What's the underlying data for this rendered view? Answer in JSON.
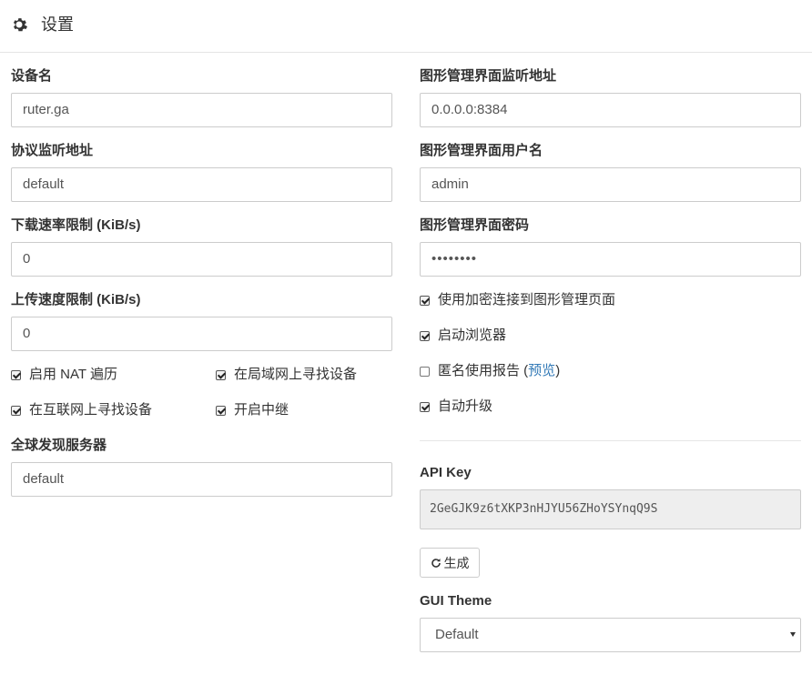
{
  "header": {
    "title": "设置",
    "icon": "gear-icon"
  },
  "left": {
    "device_name": {
      "label": "设备名",
      "value": "ruter.ga"
    },
    "protocol_listen": {
      "label": "协议监听地址",
      "value": "default"
    },
    "download_limit": {
      "label": "下载速率限制 (KiB/s)",
      "value": "0"
    },
    "upload_limit": {
      "label": "上传速度限制 (KiB/s)",
      "value": "0"
    },
    "checkboxes": {
      "nat": {
        "label": "启用 NAT 遍历",
        "checked": true
      },
      "local_discovery": {
        "label": "在局域网上寻找设备",
        "checked": true
      },
      "global_discovery": {
        "label": "在互联网上寻找设备",
        "checked": true
      },
      "relay": {
        "label": "开启中继",
        "checked": true
      }
    },
    "discovery_server": {
      "label": "全球发现服务器",
      "value": "default"
    }
  },
  "right": {
    "gui_listen": {
      "label": "图形管理界面监听地址",
      "value": "0.0.0.0:8384"
    },
    "gui_user": {
      "label": "图形管理界面用户名",
      "value": "admin"
    },
    "gui_password": {
      "label": "图形管理界面密码",
      "value": "••••••••"
    },
    "checkboxes": {
      "https": {
        "label": "使用加密连接到图形管理页面",
        "checked": true
      },
      "browser": {
        "label": "启动浏览器",
        "checked": true
      },
      "usage_report": {
        "label": "匿名使用报告 (",
        "link": "预览",
        "suffix": ")",
        "checked": false
      },
      "auto_upgrade": {
        "label": "自动升级",
        "checked": true
      }
    },
    "api_key": {
      "label": "API Key",
      "value": "2GeGJK9z6tXKP3nHJYU56ZHoYSYnqQ9S"
    },
    "generate_button": {
      "label": "生成",
      "icon": "refresh-icon"
    },
    "gui_theme": {
      "label": "GUI Theme",
      "selected": "Default"
    }
  },
  "colors": {
    "link": "#337ab7",
    "border": "#cccccc",
    "readonly_bg": "#eeeeee"
  }
}
